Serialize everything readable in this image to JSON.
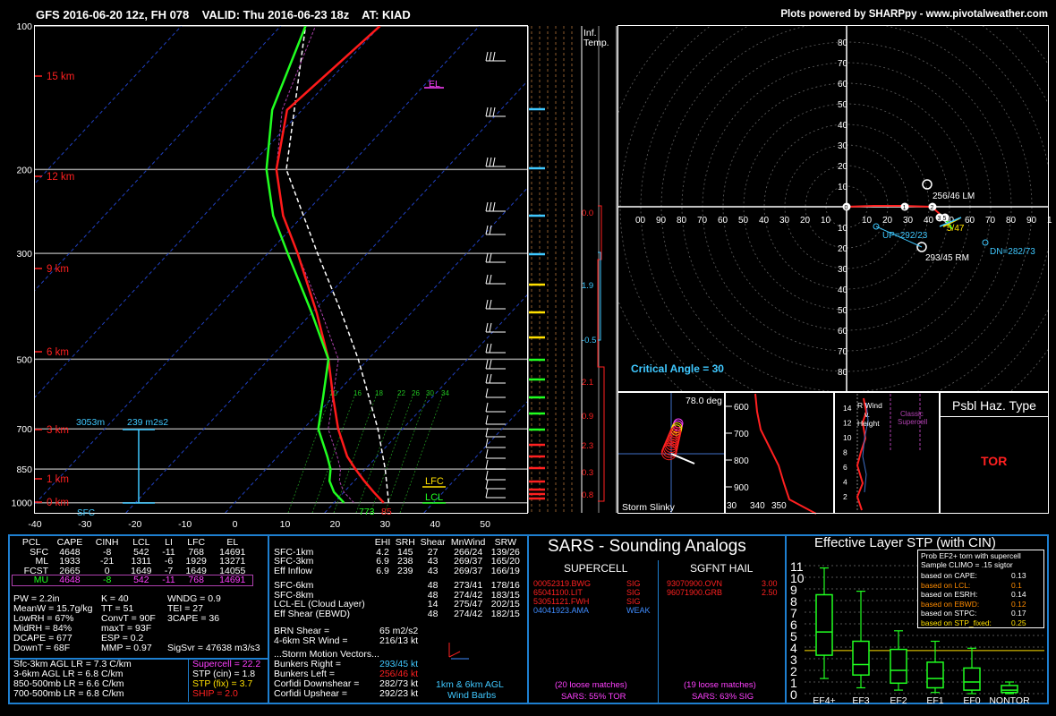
{
  "header": {
    "title": "GFS 2016-06-20 12z, FH 078    VALID: Thu 2016-06-23 18z    AT: KIAD",
    "credit": "Plots powered by SHARPpy - www.pivotalweather.com"
  },
  "chart_data": [
    {
      "type": "line",
      "name": "skew-t",
      "pressure_ticks": [
        "100",
        "200",
        "300",
        "500",
        "700",
        "850",
        "1000"
      ],
      "temp_ticks": [
        "-40",
        "-30",
        "-20",
        "-10",
        "0",
        "10",
        "20",
        "30",
        "40",
        "50"
      ],
      "height_labels": [
        "15 km",
        "12 km",
        "9 km",
        "6 km",
        "3 km",
        "1 km",
        "0 km"
      ],
      "temperature_profile": [
        [
          1000,
          30
        ],
        [
          950,
          26
        ],
        [
          900,
          22
        ],
        [
          850,
          18
        ],
        [
          800,
          14
        ],
        [
          700,
          7
        ],
        [
          600,
          0
        ],
        [
          500,
          -8
        ],
        [
          400,
          -19
        ],
        [
          300,
          -34
        ],
        [
          250,
          -44
        ],
        [
          200,
          -54
        ],
        [
          150,
          -63
        ],
        [
          100,
          -60
        ]
      ],
      "dewpoint_profile": [
        [
          1000,
          22
        ],
        [
          950,
          18
        ],
        [
          900,
          15
        ],
        [
          850,
          13
        ],
        [
          800,
          10
        ],
        [
          700,
          3
        ],
        [
          600,
          -2
        ],
        [
          500,
          -8
        ],
        [
          400,
          -20
        ],
        [
          300,
          -36
        ],
        [
          250,
          -46
        ],
        [
          200,
          -56
        ],
        [
          150,
          -66
        ],
        [
          100,
          -75
        ]
      ],
      "parcel_profile": [
        [
          1000,
          31
        ],
        [
          850,
          24
        ],
        [
          700,
          15
        ],
        [
          500,
          -2
        ],
        [
          400,
          -14
        ],
        [
          300,
          -30
        ],
        [
          200,
          -52
        ],
        [
          100,
          -75
        ]
      ],
      "el_label": "EL",
      "lfc_label": "LFC",
      "lcl_label": "LCL",
      "sfc_label": "SFC",
      "sfc_temp_label": "85",
      "sfc_dew_label": "773",
      "effective_layer_top": "3053m",
      "effective_srh": "239 m2s2",
      "mixing_ratio_labels": [
        "10",
        "16",
        "18",
        "22",
        "26",
        "30",
        "34"
      ]
    },
    {
      "type": "scatter",
      "name": "hodograph",
      "ring_labels": [
        "80",
        "70",
        "60",
        "50",
        "40",
        "30",
        "20",
        "10",
        "10",
        "20",
        "30",
        "40",
        "50",
        "60",
        "70",
        "80"
      ],
      "x_labels_left": [
        "00",
        "90",
        "80",
        "70",
        "60",
        "50",
        "40",
        "30",
        "20",
        "10"
      ],
      "x_labels_right": [
        "10",
        "20",
        "30",
        "40",
        "50",
        "60",
        "70",
        "80",
        "90",
        "1"
      ],
      "storm_motions": [
        {
          "label": "256/46 LM",
          "color": "#ffffff"
        },
        {
          "label": "293/45 RM",
          "color": "#ffffff"
        },
        {
          "label": "UP=292/23",
          "color": "#3fc8ff"
        },
        {
          "label": "DN=282/73",
          "color": "#3fc8ff"
        },
        {
          "label": "5/47",
          "color": "#ffe000"
        }
      ],
      "critical_angle": "Critical Angle = 30"
    }
  ],
  "inferred_temp": {
    "title_line1": "Inf.",
    "title_line2": "Temp.",
    "values": [
      "0.0",
      "1.9",
      "-0.5",
      "2.1",
      "0.9",
      "2.3",
      "0.3",
      "0.8"
    ]
  },
  "storm_slinky": {
    "angle": "78.0 deg",
    "label": "Storm Slinky"
  },
  "theta_e": {
    "p_labels": [
      "600",
      "700",
      "800",
      "900"
    ],
    "x_labels": [
      "30",
      "340",
      "350"
    ]
  },
  "srwind": {
    "y_labels": [
      "14",
      "12",
      "10",
      "8",
      "6",
      "4",
      "2"
    ],
    "title1": "R Wind",
    "title2": "v.",
    "title3": "Height",
    "supercell1": "Classic",
    "supercell2": "Supercell"
  },
  "haz_type": {
    "title": "Psbl Haz. Type",
    "value": "TOR"
  },
  "parcel_table": {
    "headers": [
      "PCL",
      "CAPE",
      "CINH",
      "LCL",
      "LI",
      "LFC",
      "EL"
    ],
    "rows": [
      [
        "SFC",
        "4648",
        "-8",
        "542",
        "-11",
        "768",
        "14691"
      ],
      [
        "ML",
        "1933",
        "-21",
        "1311",
        "-6",
        "1929",
        "13271"
      ],
      [
        "FCST",
        "2665",
        "0",
        "1649",
        "-7",
        "1649",
        "14055"
      ],
      [
        "MU",
        "4648",
        "-8",
        "542",
        "-11",
        "768",
        "14691"
      ]
    ]
  },
  "thermo": {
    "col1": [
      "PW = 2.2in",
      "MeanW = 15.7g/kg",
      "LowRH = 67%",
      "MidRH = 84%",
      "DCAPE = 677",
      "DownT = 68F"
    ],
    "col2": [
      "K = 40",
      "TT = 51",
      "ConvT = 90F",
      "maxT = 93F",
      "ESP = 0.2",
      "MMP = 0.97"
    ],
    "col3": [
      "WNDG = 0.9",
      "TEI = 27",
      "3CAPE = 36",
      "",
      "",
      "SigSvr = 47638 m3/s3"
    ]
  },
  "lapse_rates": [
    "Sfc-3km AGL LR = 7.3 C/km",
    "3-6km AGL LR = 6.8 C/km",
    "850-500mb LR = 6.6 C/km",
    "700-500mb LR = 6.8 C/km"
  ],
  "composites": [
    {
      "text": "Supercell = 22.2",
      "color": "#ff40ff"
    },
    {
      "text": "STP (cin) = 1.8",
      "color": "#ffffff"
    },
    {
      "text": "STP (fix) = 3.7",
      "color": "#ffe000"
    },
    {
      "text": "SHIP = 2.0",
      "color": "#ff2020"
    }
  ],
  "kinematics": {
    "headers": [
      "EHI",
      "SRH",
      "Shear",
      "MnWind",
      "SRW"
    ],
    "rows": [
      [
        "SFC-1km",
        "4.2",
        "145",
        "27",
        "266/24",
        "139/26"
      ],
      [
        "SFC-3km",
        "6.9",
        "238",
        "43",
        "269/37",
        "165/20"
      ],
      [
        "Eff Inflow",
        "6.9",
        "239",
        "43",
        "269/37",
        "166/19"
      ],
      [
        "",
        "",
        "",
        "",
        "",
        ""
      ],
      [
        "SFC-6km",
        "",
        "",
        "48",
        "273/41",
        "178/16"
      ],
      [
        "SFC-8km",
        "",
        "",
        "48",
        "274/42",
        "183/15"
      ],
      [
        "LCL-EL (Cloud Layer)",
        "",
        "",
        "14",
        "275/47",
        "202/15"
      ],
      [
        "Eff Shear (EBWD)",
        "",
        "",
        "48",
        "274/42",
        "182/15"
      ]
    ],
    "brn_label": "BRN Shear =",
    "brn_value": "65 m2/s2",
    "sr_label": "4-6km SR Wind =",
    "sr_value": "216/13 kt",
    "vectors_title": "...Storm Motion Vectors...",
    "vectors": [
      {
        "label": "Bunkers Right =",
        "value": "293/45 kt",
        "color": "#3fc8ff"
      },
      {
        "label": "Bunkers Left =",
        "value": "256/46 kt",
        "color": "#ff2020"
      },
      {
        "label": "Corfidi Downshear =",
        "value": "282/73 kt",
        "color": "#ffffff"
      },
      {
        "label": "Corfidi Upshear =",
        "value": "292/23 kt",
        "color": "#ffffff"
      }
    ],
    "barbs_caption1": "1km & 6km AGL",
    "barbs_caption2": "Wind Barbs"
  },
  "sars": {
    "title": "SARS - Sounding Analogs",
    "supercell_title": "SUPERCELL",
    "hail_title": "SGFNT HAIL",
    "supercell": [
      {
        "id": "00052319.BWG",
        "tag": "SIG",
        "color": "#ff2020"
      },
      {
        "id": "65041100.LIT",
        "tag": "SIG",
        "color": "#ff2020"
      },
      {
        "id": "53051121.FWH",
        "tag": "SIG",
        "color": "#ff2020"
      },
      {
        "id": "04041923.AMA",
        "tag": "WEAK",
        "color": "#3f8cff"
      }
    ],
    "hail": [
      {
        "id": "93070900.OVN",
        "tag": "3.00",
        "color": "#ff2020"
      },
      {
        "id": "96071900.GRB",
        "tag": "2.50",
        "color": "#ff2020"
      }
    ],
    "supercell_loose": "(20 loose matches)",
    "supercell_pct": "SARS: 55% TOR",
    "hail_loose": "(19 loose matches)",
    "hail_pct": "SARS: 63% SIG"
  },
  "stp": {
    "title": "Effective Layer STP (with CIN)",
    "y_labels": [
      "0",
      "1",
      "2",
      "3",
      "4",
      "5",
      "6",
      "7",
      "8",
      "9",
      "10",
      "11"
    ],
    "categories": [
      "EF4+",
      "EF3",
      "EF2",
      "EF1",
      "EF0",
      "NONTOR"
    ],
    "boxes": [
      {
        "min": 1.3,
        "q1": 3.3,
        "med": 5.3,
        "q3": 8.5,
        "max": 10.8
      },
      {
        "min": 0.5,
        "q1": 1.6,
        "med": 2.5,
        "q3": 4.5,
        "max": 8.8
      },
      {
        "min": 0.3,
        "q1": 0.9,
        "med": 2.0,
        "q3": 3.8,
        "max": 5.4
      },
      {
        "min": 0.1,
        "q1": 0.5,
        "med": 1.3,
        "q3": 2.7,
        "max": 4.5
      },
      {
        "min": 0.0,
        "q1": 0.3,
        "med": 1.0,
        "q3": 2.2,
        "max": 3.9
      },
      {
        "min": 0.0,
        "q1": 0.1,
        "med": 0.3,
        "q3": 0.7,
        "max": 1.0
      }
    ],
    "stp_value": 3.7,
    "prob_title1": "Prob EF2+ torn with supercell",
    "prob_title2": "Sample CLIMO = .15 sigtor",
    "probs": [
      {
        "label": "based on CAPE:",
        "value": "0.13",
        "color": "#ffffff"
      },
      {
        "label": "based on LCL:",
        "value": "0.1",
        "color": "#ff8c00"
      },
      {
        "label": "based on ESRH:",
        "value": "0.14",
        "color": "#ffffff"
      },
      {
        "label": "based on EBWD:",
        "value": "0.12",
        "color": "#ff8c00"
      },
      {
        "label": "based on STPC:",
        "value": "0.17",
        "color": "#ffffff"
      },
      {
        "label": "based on STP_fixed:",
        "value": "0.25",
        "color": "#ffe000"
      }
    ]
  }
}
